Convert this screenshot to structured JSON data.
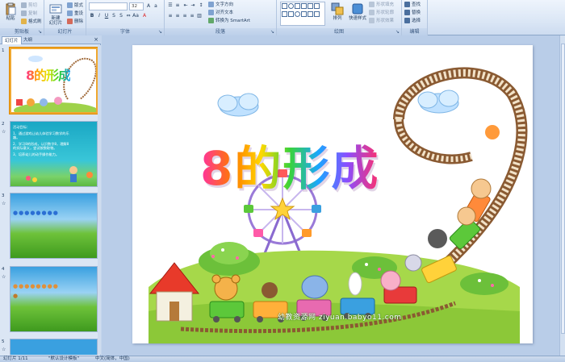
{
  "ribbon": {
    "groups": [
      {
        "name": "clipboard",
        "label": "剪贴板"
      },
      {
        "name": "slides",
        "label": "幻灯片"
      },
      {
        "name": "font",
        "label": "字体"
      },
      {
        "name": "paragraph",
        "label": "段落"
      },
      {
        "name": "drawing",
        "label": "绘图"
      },
      {
        "name": "editing",
        "label": "编辑"
      }
    ],
    "clipboard": {
      "paste": "粘贴",
      "cut": "剪切",
      "copy": "复制",
      "format_painter": "格式刷"
    },
    "slides": {
      "new_slide": "新建\n幻灯片",
      "layout": "版式",
      "reset": "重设",
      "delete": "删除"
    },
    "font": {
      "font_name": "",
      "font_size": "32"
    },
    "paragraph": {
      "text_direction": "文字方向",
      "align_text": "对齐文本",
      "convert_smartart": "转换为 SmartArt"
    },
    "drawing": {
      "arrange": "排列",
      "quick_styles": "快速样式",
      "shape_fill": "形状填充",
      "shape_outline": "形状轮廓",
      "shape_effects": "形状效果"
    },
    "editing": {
      "find": "查找",
      "replace": "替换",
      "select": "选择"
    }
  },
  "left_panel": {
    "tabs": [
      "幻灯片",
      "大纲"
    ],
    "close": "×",
    "slides": [
      {
        "number": "1",
        "title": "8的形成"
      },
      {
        "number": "2",
        "lines": [
          "活动目标：",
          "1、通过游戏让幼儿体验学习数学的乐",
          "   趣。",
          "2、学习8的形成，认识数字8，理解8",
          "   的实际意义，尝试按数取物。",
          "3、培养幼儿的动手操作能力。"
        ]
      },
      {
        "number": "3",
        "lines": []
      },
      {
        "number": "4",
        "lines": []
      },
      {
        "number": "5",
        "lines": []
      }
    ]
  },
  "slide": {
    "title": "8的形成",
    "watermark": "幼教资源网 ziyuan.babyo11.com"
  },
  "status": {
    "slide_info": "幻灯片 1/11",
    "theme": "\"默认设计模板\"",
    "language": "中文(简体，中国)"
  }
}
